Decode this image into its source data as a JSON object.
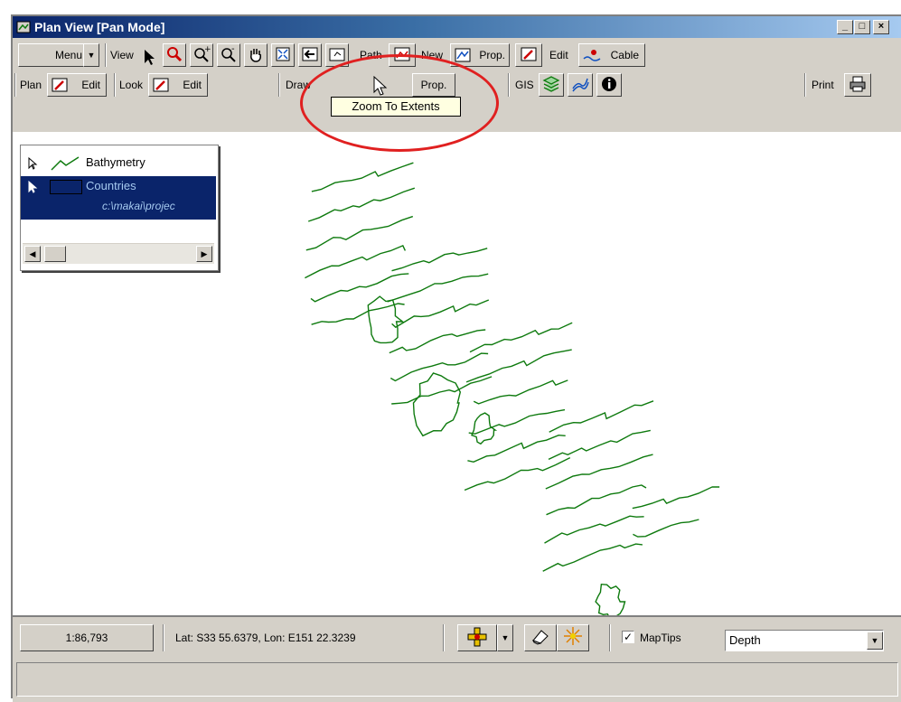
{
  "window": {
    "title": "Plan View [Pan Mode]",
    "min": "_",
    "max": "□",
    "close": "×"
  },
  "toolbar1": {
    "menu": "Menu",
    "view": "View",
    "path": "Path",
    "new": "New",
    "prop": "Prop.",
    "edit": "Edit",
    "cable": "Cable"
  },
  "toolbar2": {
    "plan": "Plan",
    "plan_edit": "Edit",
    "look": "Look",
    "look_edit": "Edit",
    "draw": "Draw",
    "prop": "Prop.",
    "gis": "GIS",
    "print": "Print"
  },
  "tooltip": "Zoom To Extents",
  "legend": {
    "layers": [
      {
        "name": "Bathymetry"
      },
      {
        "name": "Countries",
        "path": "c:\\makai\\projec"
      }
    ]
  },
  "status": {
    "scale": "1:86,793",
    "coords": "Lat: S33 55.6379, Lon: E151 22.3239",
    "maptips_label": "MapTips",
    "maptips_checked": true,
    "depth": "Depth"
  },
  "colors": {
    "contour": "#0e7a0e",
    "annotation": "#e02020",
    "title_bar": "#0a246a"
  }
}
